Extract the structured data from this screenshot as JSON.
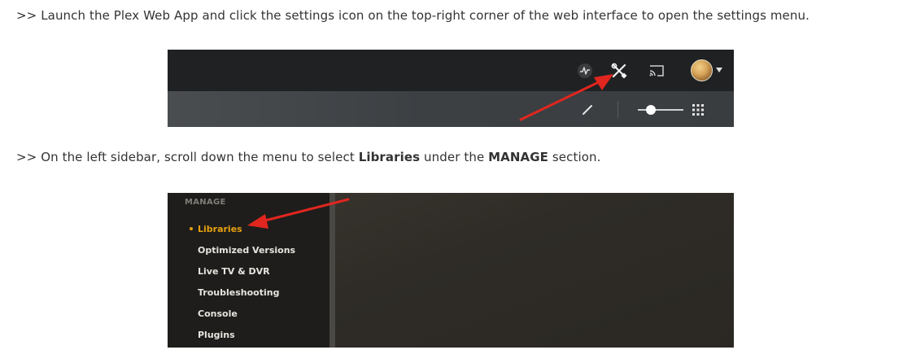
{
  "article": {
    "step1": {
      "text": ">> Launch the Plex Web App and click the settings icon on the top-right corner of the web interface to open the settings menu."
    },
    "step2": {
      "prefix": ">> On the left sidebar, scroll down the menu to select ",
      "bold1": "Libraries",
      "middle": " under the ",
      "bold2": "MANAGE",
      "suffix": " section."
    }
  },
  "screenshot1": {
    "topbar_icons": [
      "activity-icon",
      "settings-icon",
      "cast-icon",
      "avatar",
      "chevron-down-icon"
    ],
    "subbar_icons": [
      "edit-icon",
      "size-slider",
      "grid-icon"
    ],
    "slider_level": 0.25,
    "annotation_arrow_color": "#e0261f"
  },
  "screenshot2": {
    "sidebar": {
      "heading": "MANAGE",
      "items": [
        {
          "label": "Libraries",
          "active": true
        },
        {
          "label": "Optimized Versions",
          "active": false
        },
        {
          "label": "Live TV & DVR",
          "active": false
        },
        {
          "label": "Troubleshooting",
          "active": false
        },
        {
          "label": "Console",
          "active": false
        },
        {
          "label": "Plugins",
          "active": false
        }
      ]
    },
    "accent_color": "#e5a00d",
    "annotation_arrow_color": "#e0261f"
  }
}
